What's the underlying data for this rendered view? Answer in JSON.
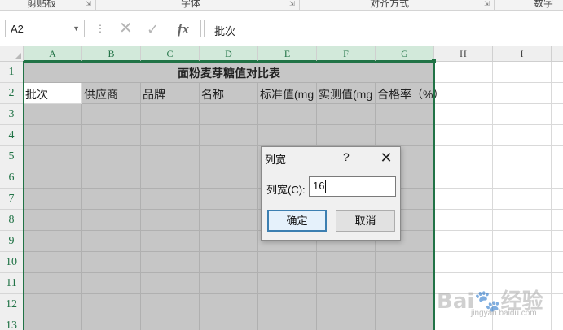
{
  "ribbon": {
    "groups": [
      "剪贴板",
      "字体",
      "对齐方式",
      "数字"
    ]
  },
  "formula_bar": {
    "name_box": "A2",
    "content": "批次"
  },
  "grid": {
    "columns": [
      "A",
      "B",
      "C",
      "D",
      "E",
      "F",
      "G",
      "H",
      "I"
    ],
    "rows": [
      "1",
      "2",
      "3",
      "4",
      "5",
      "6",
      "7",
      "8",
      "9",
      "10",
      "11",
      "12",
      "13"
    ],
    "title": "面粉麦芽糖值对比表",
    "headers": [
      "批次",
      "供应商",
      "品牌",
      "名称",
      "标准值(mg",
      "实测值(mg",
      "合格率（%）"
    ]
  },
  "dialog": {
    "title": "列宽",
    "help": "?",
    "close": "✕",
    "label": "列宽(C):",
    "value": "16",
    "ok_label": "确定",
    "cancel_label": "取消"
  },
  "watermark": {
    "text": "Bai🐾经验",
    "sub": "jingyan.baidu.com"
  },
  "colors": {
    "accent": "#217346",
    "selection": "#c6c6c6",
    "header_bg": "#efefef",
    "selected_header_bg": "#d2e9da"
  }
}
